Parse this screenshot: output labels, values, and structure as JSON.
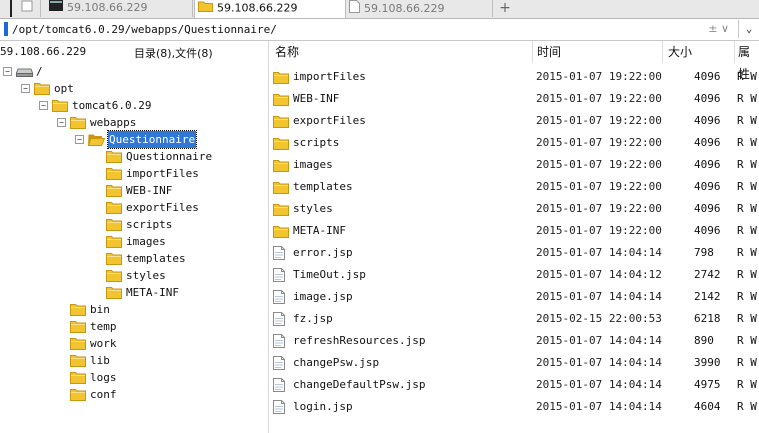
{
  "tabs": [
    {
      "label": "59.108.66.229",
      "active": false
    },
    {
      "label": "59.108.66.229",
      "active": true
    },
    {
      "label": "59.108.66.229",
      "active": false
    }
  ],
  "new_tab_label": "+",
  "path": "/opt/tomcat6.0.29/webapps/Questionnaire/",
  "path_control": "± ∨",
  "path_dropdown": "⌄",
  "left_host": "59.108.66.229",
  "left_counts": "目录(8),文件(8)",
  "columns": {
    "name": "名称",
    "time": "时间",
    "size": "大小",
    "attr": "属性"
  },
  "tree": [
    {
      "label": "/",
      "level": 0,
      "expander": "−",
      "icon": "drive-icon"
    },
    {
      "label": "opt",
      "level": 1,
      "expander": "−",
      "icon": "folder-icon"
    },
    {
      "label": "tomcat6.0.29",
      "level": 2,
      "expander": "−",
      "icon": "folder-icon"
    },
    {
      "label": "webapps",
      "level": 3,
      "expander": "−",
      "icon": "folder-icon"
    },
    {
      "label": "Questionnaire",
      "level": 4,
      "expander": "−",
      "icon": "folder-open-icon",
      "selected": true
    },
    {
      "label": "Questionnaire",
      "level": 5,
      "expander": "",
      "icon": "folder-icon"
    },
    {
      "label": "importFiles",
      "level": 5,
      "expander": "",
      "icon": "folder-icon"
    },
    {
      "label": "WEB-INF",
      "level": 5,
      "expander": "",
      "icon": "folder-icon"
    },
    {
      "label": "exportFiles",
      "level": 5,
      "expander": "",
      "icon": "folder-icon"
    },
    {
      "label": "scripts",
      "level": 5,
      "expander": "",
      "icon": "folder-icon"
    },
    {
      "label": "images",
      "level": 5,
      "expander": "",
      "icon": "folder-icon"
    },
    {
      "label": "templates",
      "level": 5,
      "expander": "",
      "icon": "folder-icon"
    },
    {
      "label": "styles",
      "level": 5,
      "expander": "",
      "icon": "folder-icon"
    },
    {
      "label": "META-INF",
      "level": 5,
      "expander": "",
      "icon": "folder-icon"
    },
    {
      "label": "bin",
      "level": 3,
      "expander": "",
      "icon": "folder-icon"
    },
    {
      "label": "temp",
      "level": 3,
      "expander": "",
      "icon": "folder-icon"
    },
    {
      "label": "work",
      "level": 3,
      "expander": "",
      "icon": "folder-icon"
    },
    {
      "label": "lib",
      "level": 3,
      "expander": "",
      "icon": "folder-icon"
    },
    {
      "label": "logs",
      "level": 3,
      "expander": "",
      "icon": "folder-icon"
    },
    {
      "label": "conf",
      "level": 3,
      "expander": "",
      "icon": "folder-icon"
    }
  ],
  "files": [
    {
      "name": "importFiles",
      "time": "2015-01-07 19:22:00",
      "size": "4096",
      "attr": "R W",
      "type": "folder"
    },
    {
      "name": "WEB-INF",
      "time": "2015-01-07 19:22:00",
      "size": "4096",
      "attr": "R W",
      "type": "folder"
    },
    {
      "name": "exportFiles",
      "time": "2015-01-07 19:22:00",
      "size": "4096",
      "attr": "R W",
      "type": "folder"
    },
    {
      "name": "scripts",
      "time": "2015-01-07 19:22:00",
      "size": "4096",
      "attr": "R W",
      "type": "folder"
    },
    {
      "name": "images",
      "time": "2015-01-07 19:22:00",
      "size": "4096",
      "attr": "R W",
      "type": "folder"
    },
    {
      "name": "templates",
      "time": "2015-01-07 19:22:00",
      "size": "4096",
      "attr": "R W",
      "type": "folder"
    },
    {
      "name": "styles",
      "time": "2015-01-07 19:22:00",
      "size": "4096",
      "attr": "R W",
      "type": "folder"
    },
    {
      "name": "META-INF",
      "time": "2015-01-07 19:22:00",
      "size": "4096",
      "attr": "R W",
      "type": "folder"
    },
    {
      "name": "error.jsp",
      "time": "2015-01-07 14:04:14",
      "size": "798",
      "attr": "R W",
      "type": "file"
    },
    {
      "name": "TimeOut.jsp",
      "time": "2015-01-07 14:04:12",
      "size": "2742",
      "attr": "R W",
      "type": "file"
    },
    {
      "name": "image.jsp",
      "time": "2015-01-07 14:04:14",
      "size": "2142",
      "attr": "R W",
      "type": "file"
    },
    {
      "name": "fz.jsp",
      "time": "2015-02-15 22:00:53",
      "size": "6218",
      "attr": "R W",
      "type": "file"
    },
    {
      "name": "refreshResources.jsp",
      "time": "2015-01-07 14:04:14",
      "size": "890",
      "attr": "R W",
      "type": "file"
    },
    {
      "name": "changePsw.jsp",
      "time": "2015-01-07 14:04:14",
      "size": "3990",
      "attr": "R W",
      "type": "file"
    },
    {
      "name": "changeDefaultPsw.jsp",
      "time": "2015-01-07 14:04:14",
      "size": "4975",
      "attr": "R W",
      "type": "file"
    },
    {
      "name": "login.jsp",
      "time": "2015-01-07 14:04:14",
      "size": "4604",
      "attr": "R W",
      "type": "file"
    }
  ],
  "colors": {
    "selection": "#3078d6",
    "folder": "#f2c430",
    "folder_dark": "#c99612"
  }
}
